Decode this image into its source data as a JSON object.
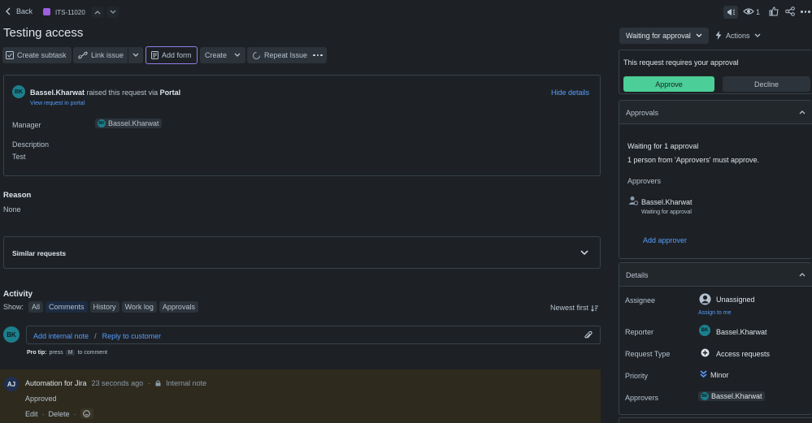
{
  "nav": {
    "back_label": "Back",
    "issue_key": "ITS-11020",
    "watch_count": "1"
  },
  "issue": {
    "title": "Testing access"
  },
  "toolbar": {
    "create_subtask": "Create subtask",
    "link_issue": "Link issue",
    "add_form": "Add form",
    "create": "Create",
    "repeat_issue": "Repeat Issue"
  },
  "request": {
    "reporter": "Bassel.Kharwat",
    "raised_text": "raised this request via",
    "channel": "Portal",
    "view_portal": "View request in portal",
    "hide_details": "Hide details",
    "manager_label": "Manager",
    "manager_value": "Bassel.Kharwat",
    "manager_initials": "BK",
    "description_label": "Description",
    "description_value": "Test",
    "reporter_initials": "BK"
  },
  "reason": {
    "label": "Reason",
    "value": "None"
  },
  "similar": {
    "label": "Similar requests"
  },
  "activity": {
    "heading": "Activity",
    "show_label": "Show:",
    "filters": [
      "All",
      "Comments",
      "History",
      "Work log",
      "Approvals"
    ],
    "sort_label": "Newest first",
    "user_initials": "BK",
    "add_internal_note": "Add internal note",
    "separator": "/",
    "reply_customer": "Reply to customer",
    "protip_bold": "Pro tip:",
    "protip_press": "press",
    "protip_key": "M",
    "protip_rest": "to comment"
  },
  "comment": {
    "initials": "AJ",
    "author": "Automation for Jira",
    "time": "23 seconds ago",
    "bullet": "·",
    "visibility": "Internal note",
    "body": "Approved",
    "edit": "Edit",
    "dot": "·",
    "delete": "Delete"
  },
  "status": {
    "label": "Waiting for approval",
    "actions": "Actions"
  },
  "approval_box": {
    "text": "This request requires your approval",
    "approve": "Approve",
    "decline": "Decline"
  },
  "approvals": {
    "heading": "Approvals",
    "waiting": "Waiting for 1 approval",
    "rule": "1 person from 'Approvers' must approve.",
    "approvers_label": "Approvers",
    "approver_name": "Bassel.Kharwat",
    "approver_status": "Waiting for approval",
    "add_approver": "Add approver"
  },
  "details": {
    "heading": "Details",
    "assignee_label": "Assignee",
    "assignee_value": "Unassigned",
    "assign_to_me": "Assign to me",
    "reporter_label": "Reporter",
    "reporter_value": "Bassel.Kharwat",
    "reporter_initials": "BK",
    "request_type_label": "Request Type",
    "request_type_value": "Access requests",
    "priority_label": "Priority",
    "priority_value": "Minor",
    "approvers_label": "Approvers",
    "approvers_value": "Bassel.Kharwat",
    "approvers_initials": "BK"
  },
  "colors": {
    "background": "#1d2125",
    "accent_blue": "#579dff",
    "approve_green": "#4bce97",
    "comment_bg": "#2e2a1e",
    "avatar_teal": "#1d7f8c"
  }
}
